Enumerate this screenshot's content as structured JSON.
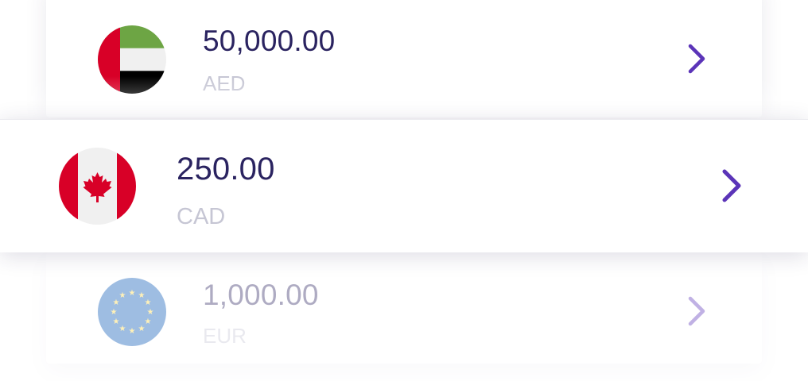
{
  "accounts": [
    {
      "amount": "50,000.00",
      "currency": "AED",
      "flag_icon": "uae-flag-icon",
      "chevron_icon": "chevron-right-icon",
      "state": "faded-above"
    },
    {
      "amount": "250.00",
      "currency": "CAD",
      "flag_icon": "canada-flag-icon",
      "chevron_icon": "chevron-right-icon",
      "state": "selected"
    },
    {
      "amount": "1,000.00",
      "currency": "EUR",
      "flag_icon": "eu-flag-icon",
      "chevron_icon": "chevron-right-icon",
      "state": "faded-below"
    }
  ],
  "colors": {
    "amount_text": "#2a2360",
    "currency_text": "#c6c6d4",
    "chevron": "#5b34b8",
    "uae_green": "#6da544",
    "uae_red": "#d80027",
    "canada_red": "#d80027",
    "eu_blue": "#0052b4",
    "eu_star": "#ffda44"
  }
}
